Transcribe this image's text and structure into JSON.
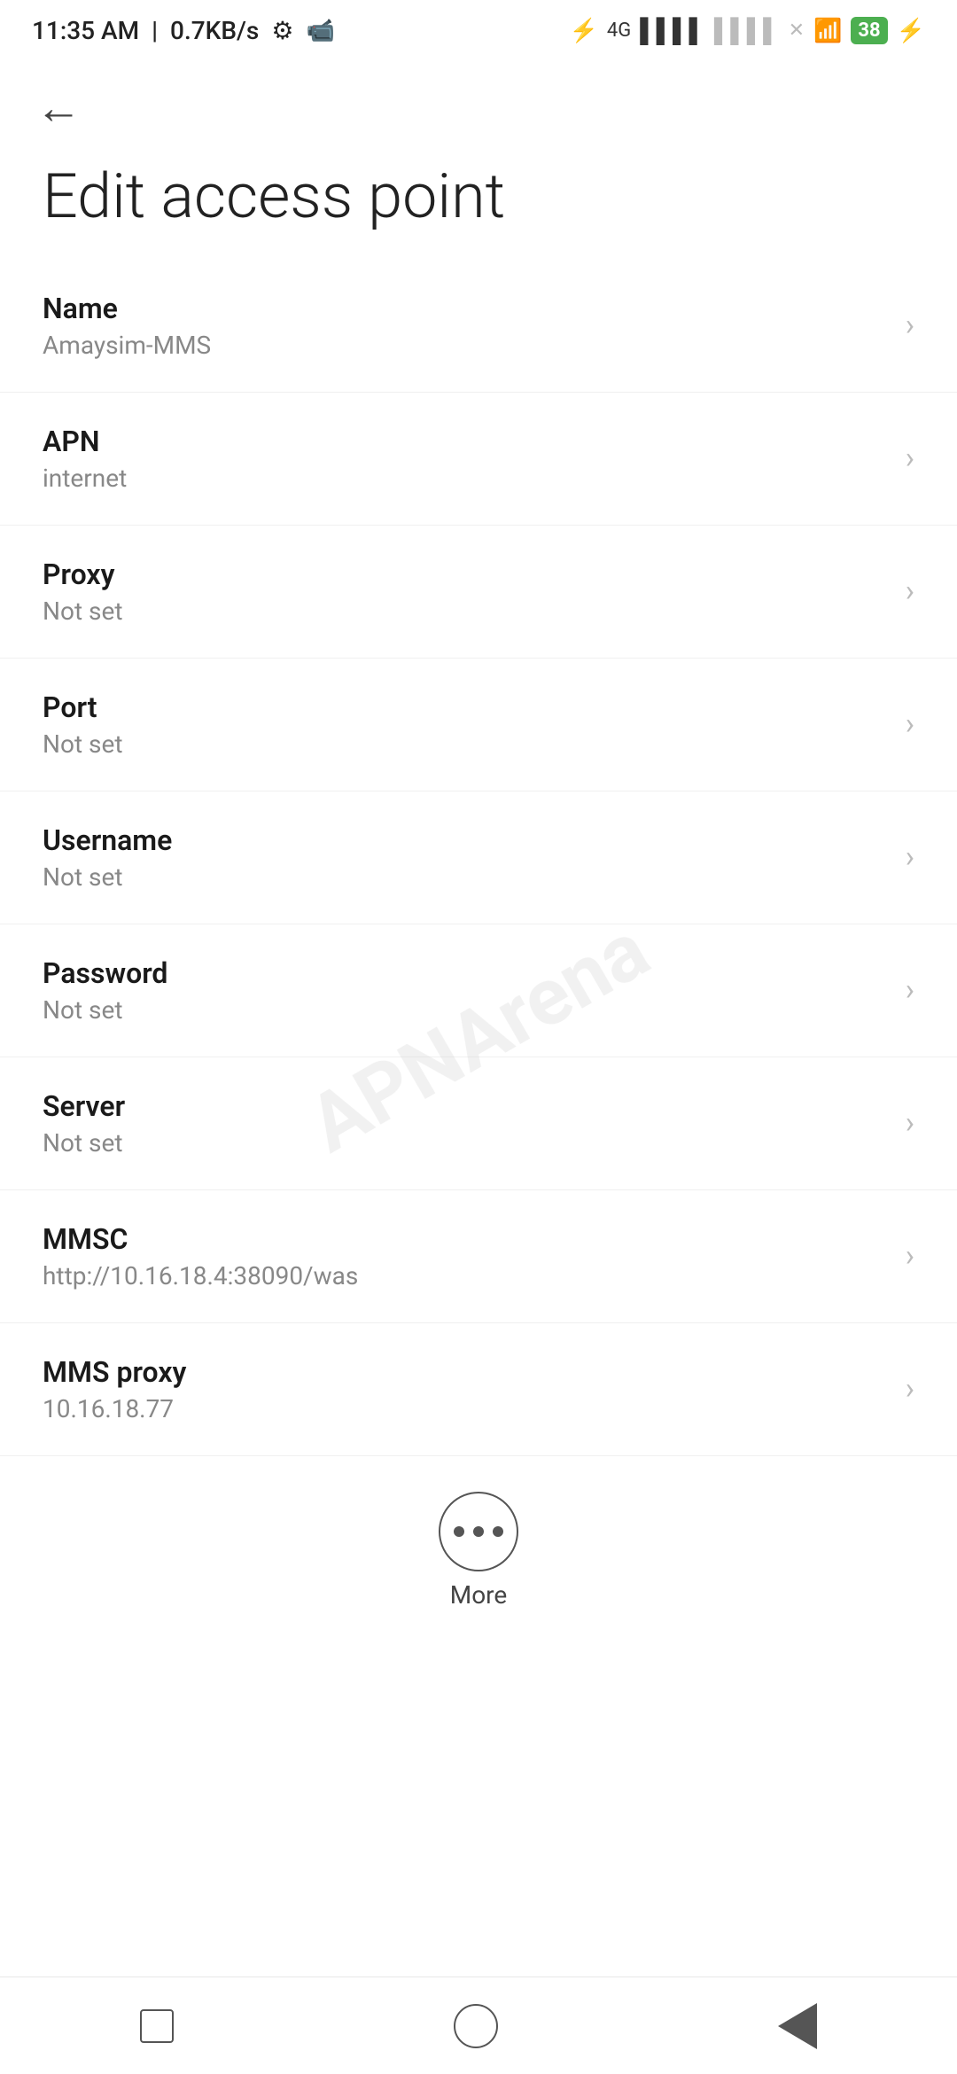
{
  "status_bar": {
    "time": "11:35 AM",
    "speed": "0.7KB/s"
  },
  "page": {
    "title": "Edit access point",
    "back_label": "Back"
  },
  "settings_items": [
    {
      "id": "name",
      "label": "Name",
      "value": "Amaysim-MMS"
    },
    {
      "id": "apn",
      "label": "APN",
      "value": "internet"
    },
    {
      "id": "proxy",
      "label": "Proxy",
      "value": "Not set"
    },
    {
      "id": "port",
      "label": "Port",
      "value": "Not set"
    },
    {
      "id": "username",
      "label": "Username",
      "value": "Not set"
    },
    {
      "id": "password",
      "label": "Password",
      "value": "Not set"
    },
    {
      "id": "server",
      "label": "Server",
      "value": "Not set"
    },
    {
      "id": "mmsc",
      "label": "MMSC",
      "value": "http://10.16.18.4:38090/was"
    },
    {
      "id": "mms-proxy",
      "label": "MMS proxy",
      "value": "10.16.18.77"
    }
  ],
  "more_button": {
    "label": "More"
  },
  "watermark": "APNArena",
  "bottom_nav": {
    "recents": "Recents",
    "home": "Home",
    "back": "Back"
  }
}
